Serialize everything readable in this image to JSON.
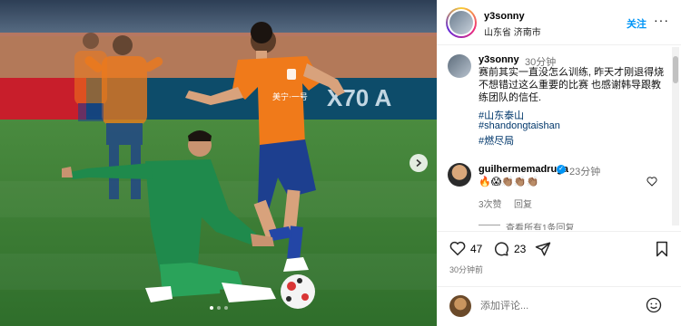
{
  "photo": {
    "banner_text": "X70 A",
    "jersey_text": "美宁·一号",
    "carousel": {
      "count": 3,
      "active": 0
    }
  },
  "header": {
    "username": "y3sonny",
    "location": "山东省 济南市",
    "follow_label": "关注",
    "more_label": "···"
  },
  "caption": {
    "username": "y3sonny",
    "time": "30分钟",
    "text": "赛前其实一直没怎么训练, 昨天才刚退得烧 不想错过这么重要的比赛 也感谢韩导跟教练团队的信任.",
    "hashtags": [
      "#山东泰山",
      "#shandongtaishan",
      "#燃尽局"
    ]
  },
  "comment": {
    "username": "guilhermemadruga",
    "time": "23分钟",
    "text": "🔥😱👏🏽👏🏽👏🏽",
    "likes": "3次赞",
    "reply_label": "回复",
    "view_replies": "查看所有1条回复"
  },
  "actions": {
    "like_count": "47",
    "comment_count": "23",
    "time_ago": "30分钟前"
  },
  "composer": {
    "placeholder": "添加评论..."
  },
  "colors": {
    "accent": "#0095f6",
    "hashtag": "#00376b",
    "orange_kit": "#f07a1a",
    "green_kit": "#1f8a4c"
  }
}
